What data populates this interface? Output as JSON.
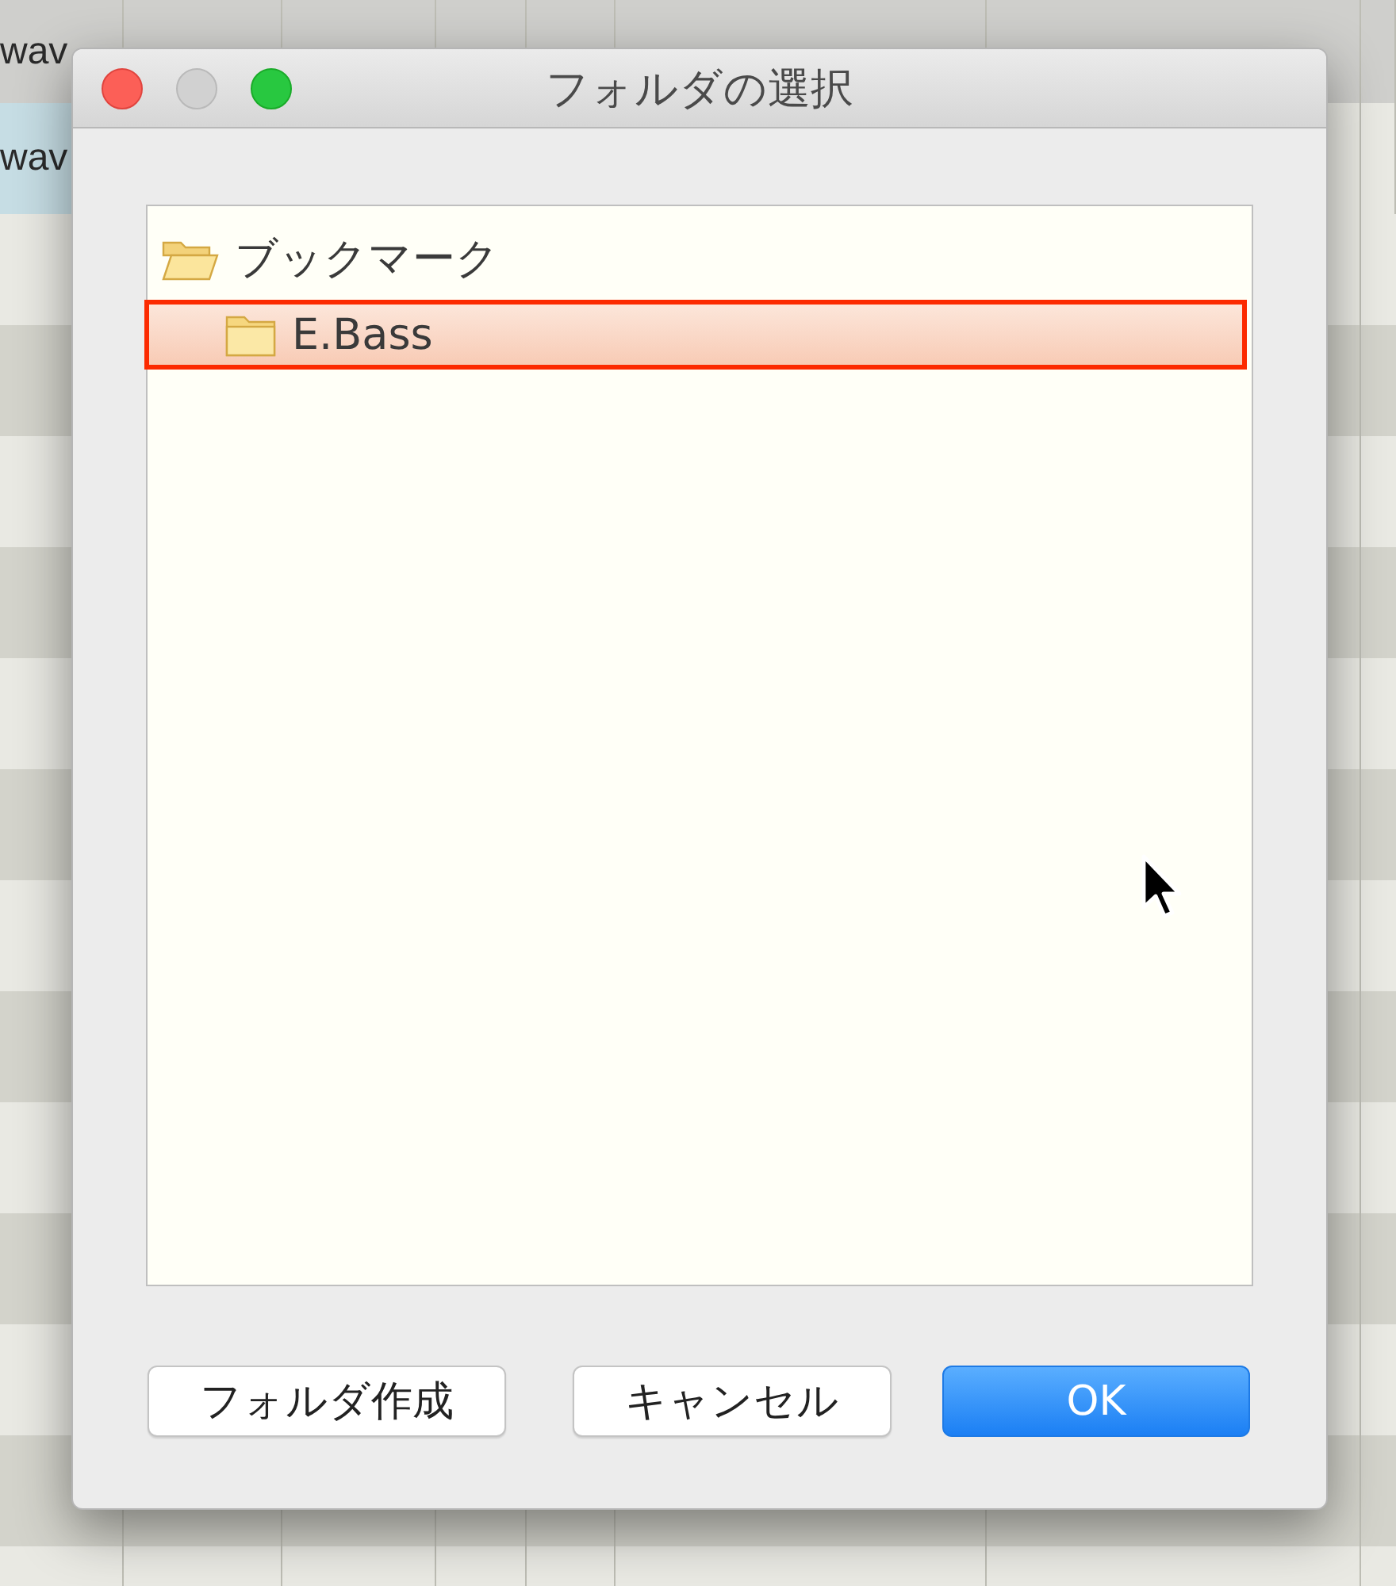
{
  "background_table": {
    "rows": [
      {
        "cells": [
          "wav"
        ],
        "selected": false
      },
      {
        "cells": [
          "wav"
        ],
        "selected": true
      }
    ]
  },
  "dialog": {
    "title": "フォルダの選択",
    "window_controls": [
      {
        "kind": "close",
        "disabled": false
      },
      {
        "kind": "minimize",
        "disabled": true
      },
      {
        "kind": "zoom",
        "disabled": false
      }
    ],
    "tree": [
      {
        "label": "ブックマーク",
        "expanded": true,
        "selected": false,
        "children": [
          {
            "label": "E.Bass",
            "expanded": false,
            "selected": true
          }
        ]
      }
    ],
    "buttons": [
      {
        "label": "フォルダ作成",
        "default": false
      },
      {
        "label": "キャンセル",
        "default": false
      },
      {
        "label": "OK",
        "default": true
      }
    ]
  }
}
